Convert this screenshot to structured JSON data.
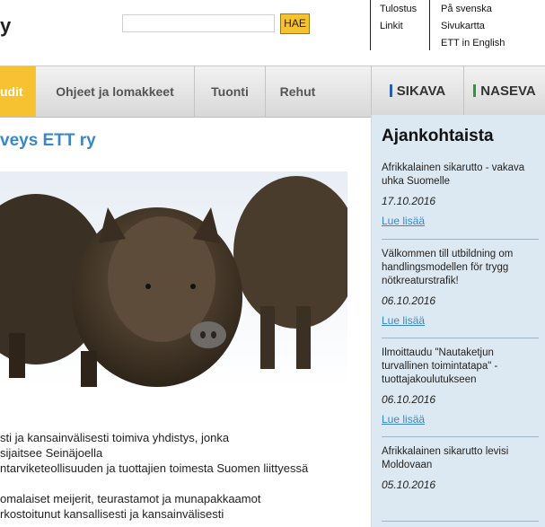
{
  "header": {
    "logo_text": "y",
    "search_placeholder": "",
    "search_button": "HAE",
    "utility_col1": [
      "Tulostus",
      "Linkit"
    ],
    "utility_col2": [
      "På svenska",
      "Sivukartta",
      "ETT in English"
    ]
  },
  "nav": {
    "items": [
      "udit",
      "Ohjeet ja lomakkeet",
      "Tuonti",
      "Rehut"
    ],
    "brands": [
      "SIKAVA",
      "NASEVA"
    ]
  },
  "main": {
    "title": "veys ETT ry",
    "lines": [
      "sti ja kansainvälisesti toimiva yhdistys, jonka",
      " sijaitsee Seinäjoella",
      "ntarviketeollisuuden ja tuottajien toimesta Suomen liittyessä",
      "",
      "omalaiset meijerit, teurastamot ja munapakkaamot",
      "rkostoitunut kansallisesti ja kansainvälisesti"
    ]
  },
  "sidebar": {
    "title": "Ajankohtaista",
    "news": [
      {
        "title": "Afrikkalainen sikarutto - vakava uhka Suomelle",
        "date": "17.10.2016",
        "link": "Lue lisää"
      },
      {
        "title": "Välkommen till utbildning om handlingsmodellen för trygg nötkreaturstrafik!",
        "date": "06.10.2016",
        "link": "Lue lisää"
      },
      {
        "title": "Ilmoittaudu \"Nautaketjun turvallinen toimintatapa\" -tuottajakoulutukseen",
        "date": "06.10.2016",
        "link": "Lue lisää"
      },
      {
        "title": "Afrikkalainen sikarutto levisi Moldovaan",
        "date": "05.10.2016",
        "link": ""
      }
    ]
  },
  "colors": {
    "accent": "#f6c232",
    "link": "#3a87c8",
    "sidebar_bg": "#dce9f2",
    "sikava_mark": "#2a5bb0",
    "naseva_mark": "#2a9a3a"
  },
  "icons": [
    "wild-boar-photo"
  ]
}
